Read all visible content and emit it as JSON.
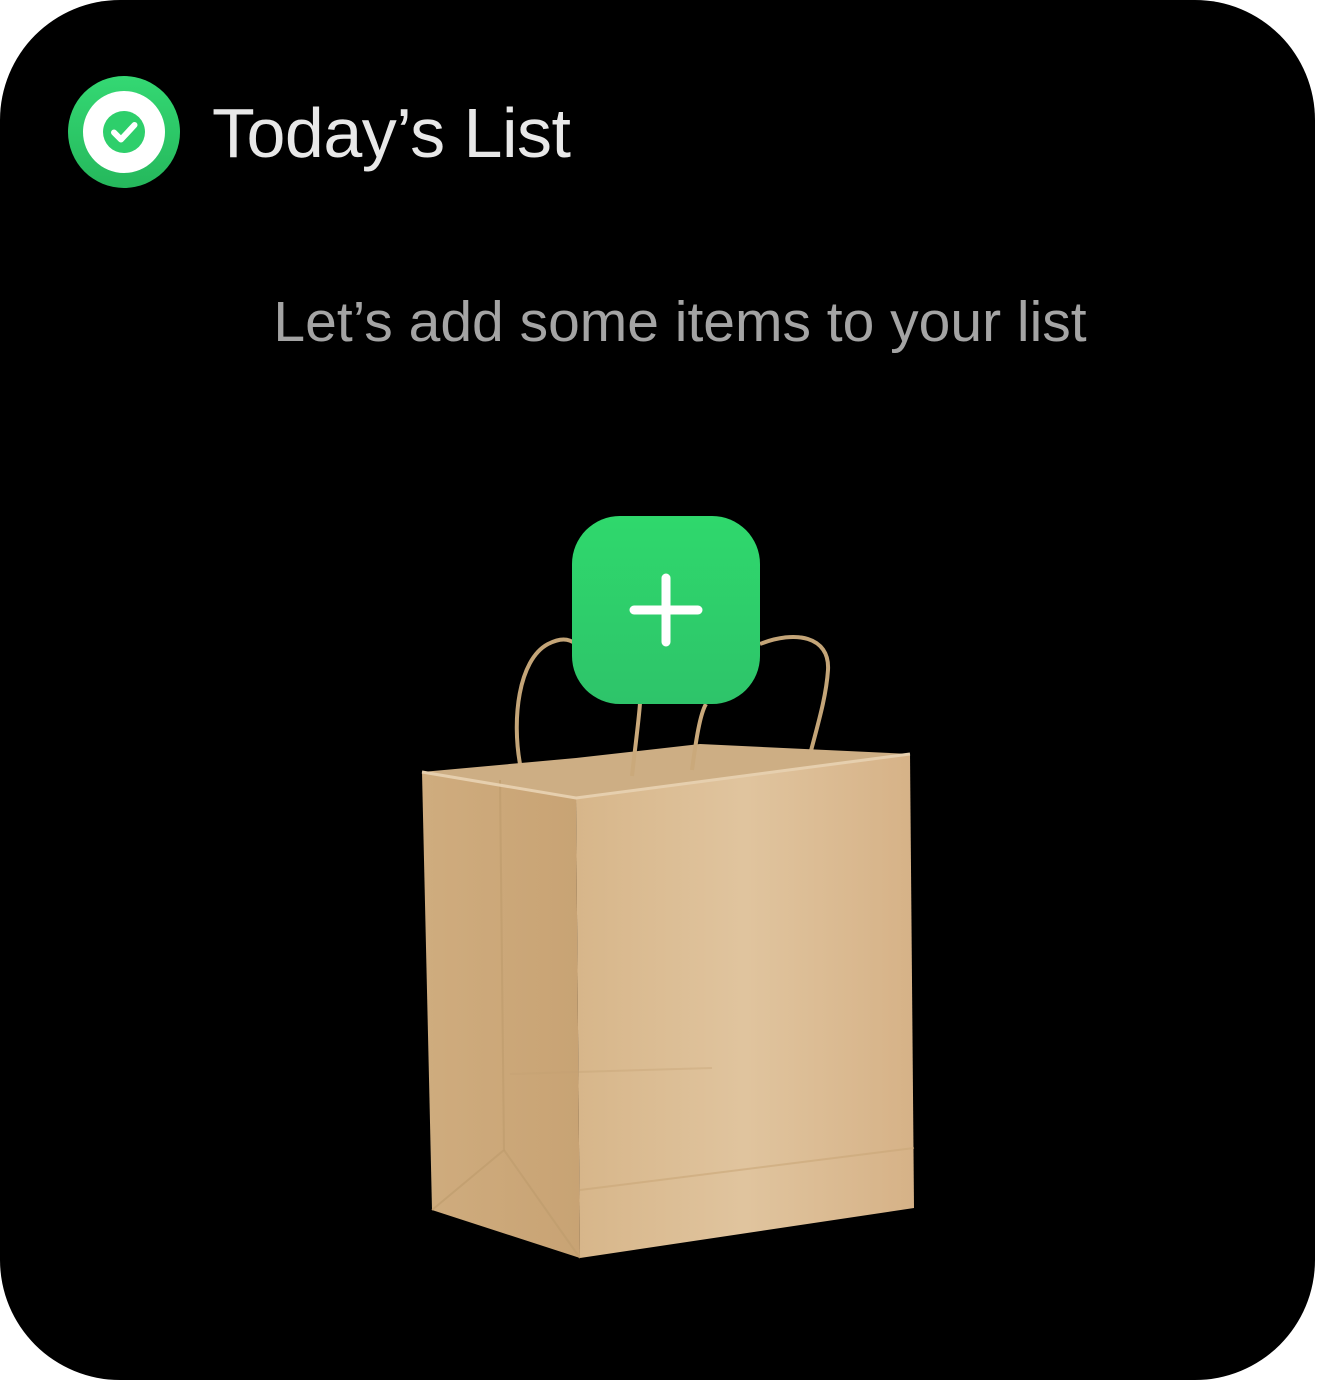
{
  "widget": {
    "title": "Today’s List",
    "title_icon": "checkmark-circle-icon",
    "empty_message": "Let’s add some items to your list",
    "empty_illustration": "paper-shopping-bag",
    "add_button_icon": "plus-icon"
  },
  "colors": {
    "accent_green": "#2ecf6b",
    "background": "#000000",
    "title_text": "#e8e8e8",
    "message_text": "#a4a4a4",
    "bag_kraft": "#d9b98e"
  }
}
